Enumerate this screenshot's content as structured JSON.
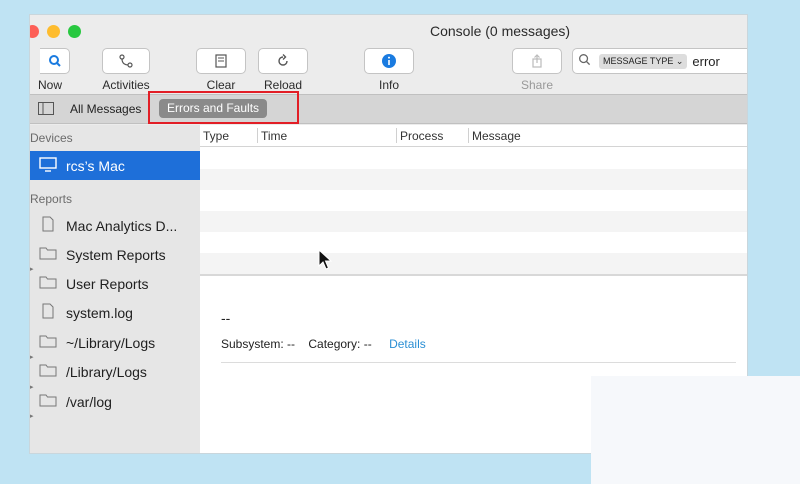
{
  "window": {
    "title": "Console (0 messages)"
  },
  "toolbar": {
    "now": "Now",
    "activities": "Activities",
    "clear": "Clear",
    "reload": "Reload",
    "info": "Info",
    "share": "Share",
    "search_token": "MESSAGE TYPE ⌄",
    "search_value": "error"
  },
  "filterbar": {
    "all_messages": "All Messages",
    "errors_and_faults": "Errors and Faults"
  },
  "sidebar": {
    "devices_heading": "Devices",
    "reports_heading": "Reports",
    "device": "rcs’s Mac",
    "items": [
      {
        "label": "Mac Analytics D...",
        "icon": "document-icon"
      },
      {
        "label": "System Reports",
        "icon": "folder-icon"
      },
      {
        "label": "User Reports",
        "icon": "folder-icon"
      },
      {
        "label": "system.log",
        "icon": "document-icon"
      },
      {
        "label": "~/Library/Logs",
        "icon": "folder-icon"
      },
      {
        "label": "/Library/Logs",
        "icon": "folder-icon"
      },
      {
        "label": "/var/log",
        "icon": "folder-icon"
      }
    ]
  },
  "table": {
    "columns": [
      "Type",
      "Time",
      "Process",
      "Message"
    ]
  },
  "detail": {
    "title": "--",
    "subsystem": "Subsystem: --",
    "category": "Category: --",
    "details_link": "Details"
  },
  "colors": {
    "selection": "#1e6fd9",
    "link": "#2b8fd4",
    "highlight_box": "#e21e26"
  }
}
